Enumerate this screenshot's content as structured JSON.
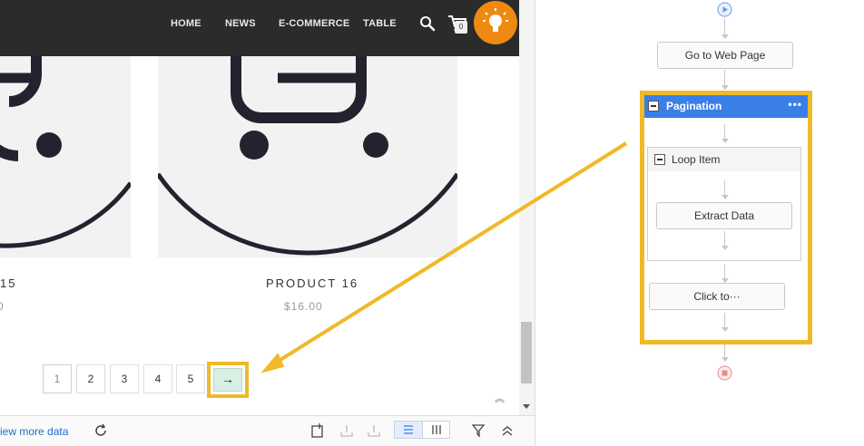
{
  "nav": {
    "items": [
      "HOME",
      "NEWS",
      "E-COMMERCE",
      "TABLE"
    ],
    "cart_count": "0"
  },
  "products": [
    {
      "name": "15",
      "price": "0"
    },
    {
      "name": "PRODUCT 16",
      "price": "$16.00"
    }
  ],
  "pagination": {
    "pages": [
      "1",
      "2",
      "3",
      "4",
      "5"
    ],
    "active_page": "1",
    "next": "→"
  },
  "bottom_bar": {
    "view_more": "iew more data"
  },
  "workflow": {
    "goto": "Go to Web Page",
    "pagination_title": "Pagination",
    "pagination_menu": "•••",
    "loop_title": "Loop Item",
    "extract": "Extract Data",
    "click": "Click to···"
  },
  "colors": {
    "highlight": "#f0b928",
    "accent_blue": "#3a7fe8",
    "nav_bg": "#2b2b2b",
    "bulb": "#ee8a12"
  },
  "icons": [
    "search-icon",
    "cart-icon",
    "lightbulb-icon",
    "refresh-icon",
    "export-icon",
    "filter-icon",
    "list-view-icon",
    "column-view-icon",
    "play-icon",
    "stop-icon"
  ]
}
